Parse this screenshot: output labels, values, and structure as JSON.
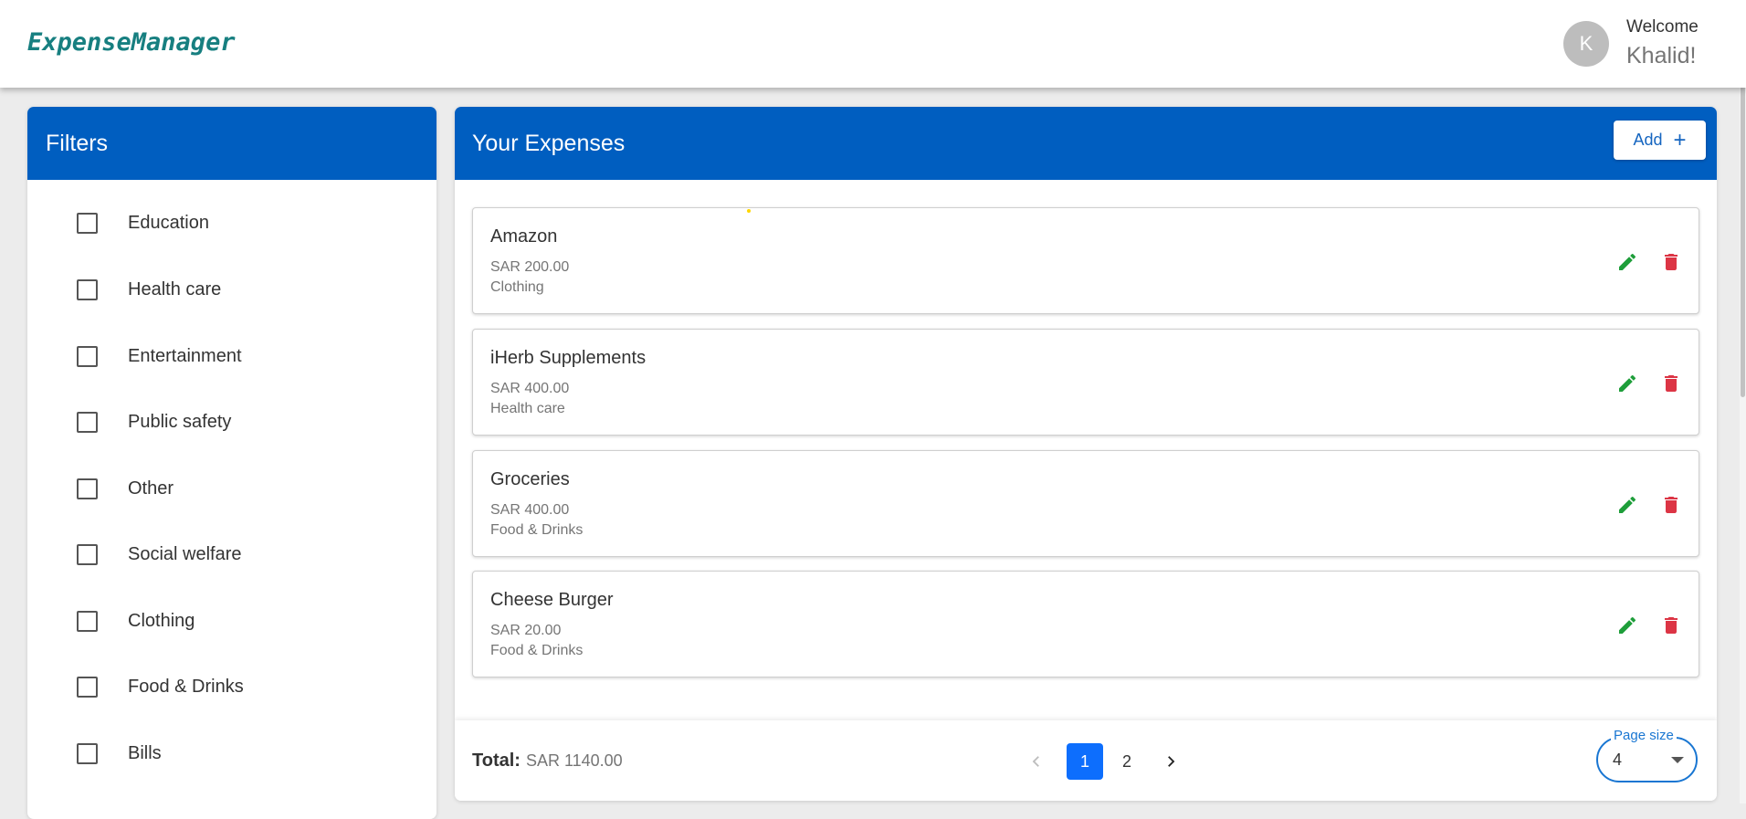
{
  "app": {
    "brand": "ExpenseManager",
    "welcome": "Welcome",
    "user_name": "Khalid!",
    "avatar_initial": "K"
  },
  "filters": {
    "title": "Filters",
    "items": [
      {
        "label": "Education",
        "checked": false
      },
      {
        "label": "Health care",
        "checked": false
      },
      {
        "label": "Entertainment",
        "checked": false
      },
      {
        "label": "Public safety",
        "checked": false
      },
      {
        "label": "Other",
        "checked": false
      },
      {
        "label": "Social welfare",
        "checked": false
      },
      {
        "label": "Clothing",
        "checked": false
      },
      {
        "label": "Food & Drinks",
        "checked": false
      },
      {
        "label": "Bills",
        "checked": false
      }
    ]
  },
  "expenses": {
    "title": "Your Expenses",
    "add_label": "Add",
    "items": [
      {
        "name": "Amazon",
        "amount": "SAR 200.00",
        "category": "Clothing"
      },
      {
        "name": "iHerb Supplements",
        "amount": "SAR 400.00",
        "category": "Health care"
      },
      {
        "name": "Groceries",
        "amount": "SAR 400.00",
        "category": "Food & Drinks"
      },
      {
        "name": "Cheese Burger",
        "amount": "SAR 20.00",
        "category": "Food & Drinks"
      }
    ],
    "total_label": "Total:",
    "total_value": "SAR 1140.00",
    "pages": [
      "1",
      "2"
    ],
    "current_page": "1",
    "page_size_label": "Page size",
    "page_size": "4"
  },
  "colors": {
    "header": "#005ec0",
    "brand": "#177f80",
    "edit": "#1e9e3a",
    "delete": "#dc3545",
    "active_page": "#0d6efd"
  },
  "icons": {
    "edit": "pencil-icon",
    "delete": "trash-icon",
    "add": "plus-icon",
    "prev": "chevron-left-icon",
    "next": "chevron-right-icon",
    "dropdown": "caret-down-icon"
  }
}
